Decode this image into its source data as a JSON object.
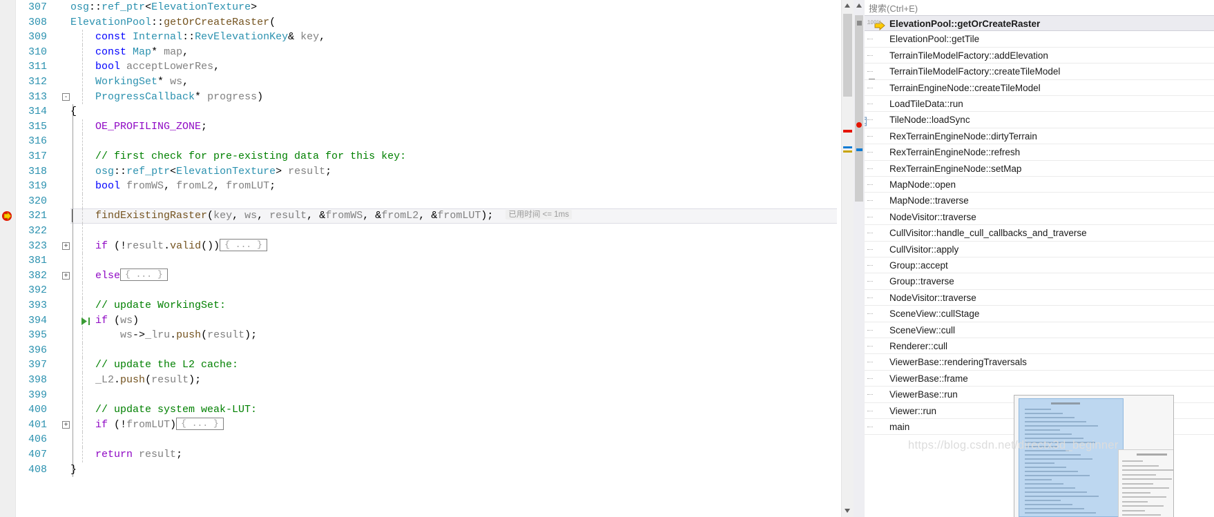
{
  "editor": {
    "language": "cpp",
    "current_line": 321,
    "breakpoint_line": 321,
    "run_to_cursor_line": 394,
    "timing_annotation": "已用时间 <= 1ms",
    "collapsed_placeholder": "{ ... }",
    "lines": [
      {
        "num": "307",
        "text": "osg::ref_ptr<ElevationTexture>",
        "indent": 0
      },
      {
        "num": "308",
        "text": "ElevationPool::getOrCreateRaster(",
        "indent": 0
      },
      {
        "num": "309",
        "text": "    const Internal::RevElevationKey& key,",
        "indent": 1
      },
      {
        "num": "310",
        "text": "    const Map* map,",
        "indent": 1
      },
      {
        "num": "311",
        "text": "    bool acceptLowerRes,",
        "indent": 1
      },
      {
        "num": "312",
        "text": "    WorkingSet* ws,",
        "indent": 1
      },
      {
        "num": "313",
        "text": "    ProgressCallback* progress)",
        "indent": 1,
        "fold": "-"
      },
      {
        "num": "314",
        "text": "{",
        "indent": 0
      },
      {
        "num": "315",
        "text": "    OE_PROFILING_ZONE;",
        "indent": 1
      },
      {
        "num": "316",
        "text": "",
        "indent": 1
      },
      {
        "num": "317",
        "text": "    // first check for pre-existing data for this key:",
        "indent": 1
      },
      {
        "num": "318",
        "text": "    osg::ref_ptr<ElevationTexture> result;",
        "indent": 1
      },
      {
        "num": "319",
        "text": "    bool fromWS, fromL2, fromLUT;",
        "indent": 1
      },
      {
        "num": "320",
        "text": "",
        "indent": 1
      },
      {
        "num": "321",
        "text": "    findExistingRaster(key, ws, result, &fromWS, &fromL2, &fromLUT);",
        "indent": 1
      },
      {
        "num": "322",
        "text": "",
        "indent": 1
      },
      {
        "num": "323",
        "text": "    if (!result.valid())",
        "indent": 1,
        "fold": "+",
        "collapsed": true
      },
      {
        "num": "381",
        "text": "",
        "indent": 1
      },
      {
        "num": "382",
        "text": "    else",
        "indent": 1,
        "fold": "+",
        "collapsed": true
      },
      {
        "num": "392",
        "text": "",
        "indent": 1
      },
      {
        "num": "393",
        "text": "    // update WorkingSet:",
        "indent": 1
      },
      {
        "num": "394",
        "text": "    if (ws)",
        "indent": 1
      },
      {
        "num": "395",
        "text": "        ws->_lru.push(result);",
        "indent": 1
      },
      {
        "num": "396",
        "text": "",
        "indent": 1
      },
      {
        "num": "397",
        "text": "    // update the L2 cache:",
        "indent": 1
      },
      {
        "num": "398",
        "text": "    _L2.push(result);",
        "indent": 1
      },
      {
        "num": "399",
        "text": "",
        "indent": 1
      },
      {
        "num": "400",
        "text": "    // update system weak-LUT:",
        "indent": 1
      },
      {
        "num": "401",
        "text": "    if (!fromLUT)",
        "indent": 1,
        "fold": "+",
        "collapsed": true
      },
      {
        "num": "406",
        "text": "",
        "indent": 1
      },
      {
        "num": "407",
        "text": "    return result;",
        "indent": 1
      },
      {
        "num": "408",
        "text": "}",
        "indent": 0
      }
    ]
  },
  "call_stack_panel": {
    "search": {
      "placeholder": "搜索(Ctrl+E)",
      "value": ""
    },
    "zoom_badge": "100%",
    "frames": [
      {
        "label": "ElevationPool::getOrCreateRaster",
        "active": true,
        "marker": "yellow-arrow"
      },
      {
        "label": "ElevationPool::getTile",
        "active": false,
        "marker": "none"
      },
      {
        "label": "TerrainTileModelFactory::addElevation",
        "active": false,
        "marker": "none"
      },
      {
        "label": "TerrainTileModelFactory::createTileModel",
        "active": false,
        "marker": "expander"
      },
      {
        "label": "TerrainEngineNode::createTileModel",
        "active": false,
        "marker": "none"
      },
      {
        "label": "LoadTileData::run",
        "active": false,
        "marker": "none"
      },
      {
        "label": "TileNode::loadSync",
        "active": false,
        "marker": "icon"
      },
      {
        "label": "RexTerrainEngineNode::dirtyTerrain",
        "active": false,
        "marker": "none"
      },
      {
        "label": "RexTerrainEngineNode::refresh",
        "active": false,
        "marker": "none"
      },
      {
        "label": "RexTerrainEngineNode::setMap",
        "active": false,
        "marker": "none"
      },
      {
        "label": "MapNode::open",
        "active": false,
        "marker": "none"
      },
      {
        "label": "MapNode::traverse",
        "active": false,
        "marker": "none"
      },
      {
        "label": "NodeVisitor::traverse",
        "active": false,
        "marker": "none"
      },
      {
        "label": "CullVisitor::handle_cull_callbacks_and_traverse",
        "active": false,
        "marker": "none"
      },
      {
        "label": "CullVisitor::apply",
        "active": false,
        "marker": "none"
      },
      {
        "label": "Group::accept",
        "active": false,
        "marker": "none"
      },
      {
        "label": "Group::traverse",
        "active": false,
        "marker": "none"
      },
      {
        "label": "NodeVisitor::traverse",
        "active": false,
        "marker": "none"
      },
      {
        "label": "SceneView::cullStage",
        "active": false,
        "marker": "none"
      },
      {
        "label": "SceneView::cull",
        "active": false,
        "marker": "none"
      },
      {
        "label": "Renderer::cull",
        "active": false,
        "marker": "none"
      },
      {
        "label": "ViewerBase::renderingTraversals",
        "active": false,
        "marker": "none"
      },
      {
        "label": "ViewerBase::frame",
        "active": false,
        "marker": "none"
      },
      {
        "label": "ViewerBase::run",
        "active": false,
        "marker": "none"
      },
      {
        "label": "Viewer::run",
        "active": false,
        "marker": "none"
      },
      {
        "label": "main",
        "active": false,
        "marker": "none"
      }
    ]
  },
  "watermark": {
    "text": "https://blog.csdn.net/directx3d_beginner"
  },
  "colors": {
    "accent_blue": "#0b7bd4",
    "line_number": "#2b91af",
    "keyword": "#0000ff",
    "keyword2": "#8f08c4",
    "type": "#2b91af",
    "comment": "#008000",
    "function": "#74531f",
    "identifier": "#808080",
    "breakpoint_red": "#e51400",
    "current_stmt_yellow": "#ffcc00",
    "run_arrow_green": "#3a9b35",
    "panel_gutter": "#eeeef2",
    "highlight_row": "#ebebf0"
  }
}
